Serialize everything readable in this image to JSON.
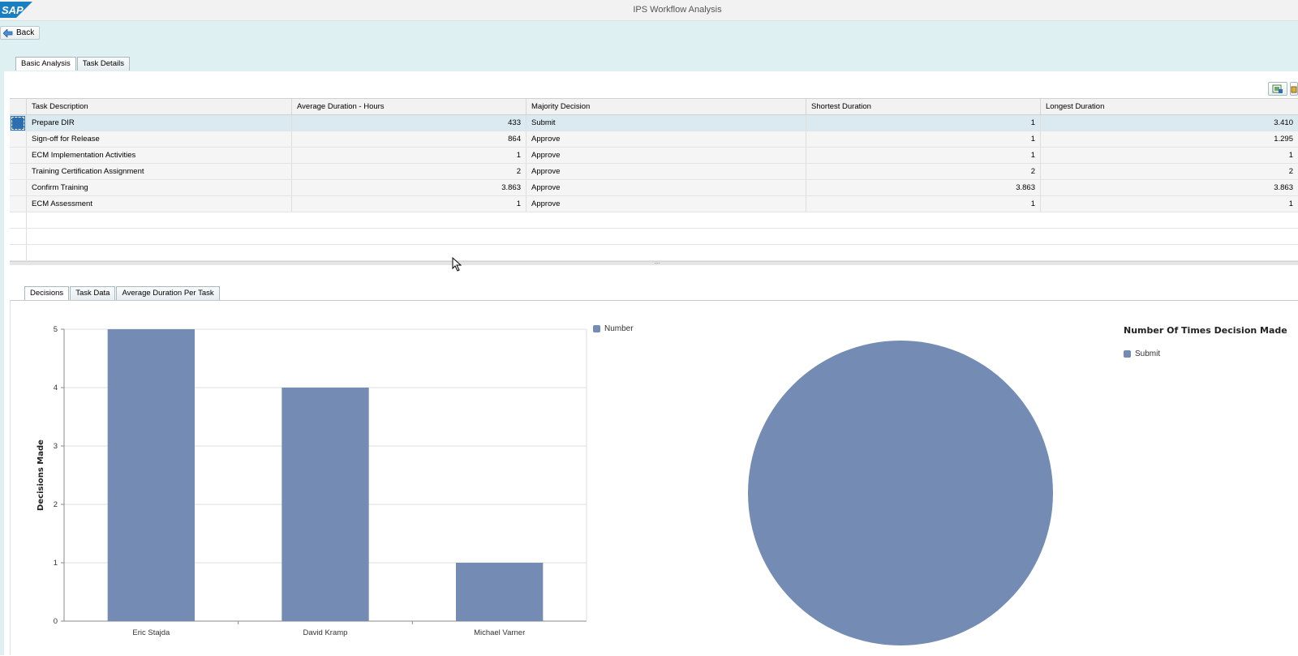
{
  "app": {
    "logo_text": "SAP",
    "title": "IPS Workflow Analysis"
  },
  "toolbar": {
    "back_label": "Back"
  },
  "top_tabs": [
    {
      "label": "Basic Analysis",
      "active": true
    },
    {
      "label": "Task Details",
      "active": false
    }
  ],
  "grid": {
    "columns": [
      "Task Description",
      "Average Duration - Hours",
      "Majority Decision",
      "Shortest Duration",
      "Longest Duration"
    ],
    "rows": [
      [
        "Prepare DIR",
        "433",
        "Submit",
        "1",
        "3.410"
      ],
      [
        "Sign-off for Release",
        "864",
        "Approve",
        "1",
        "1.295"
      ],
      [
        "ECM Implementation Activities",
        "1",
        "Approve",
        "1",
        "1"
      ],
      [
        "Training Certification Assignment",
        "2",
        "Approve",
        "2",
        "2"
      ],
      [
        "Confirm Training",
        "3.863",
        "Approve",
        "3.863",
        "3.863"
      ],
      [
        "ECM Assessment",
        "1",
        "Approve",
        "1",
        "1"
      ]
    ],
    "selected_row": 0
  },
  "bottom_tabs": [
    {
      "label": "Decisions",
      "active": true
    },
    {
      "label": "Task Data",
      "active": false
    },
    {
      "label": "Average Duration Per Task",
      "active": false
    }
  ],
  "colors": {
    "series": "#748cb3",
    "accent": "#2b6fb2"
  },
  "chart_data": [
    {
      "type": "bar",
      "categories": [
        "Eric Stajda",
        "David Kramp",
        "Michael Varner"
      ],
      "series": [
        {
          "name": "Number",
          "values": [
            5,
            4,
            1
          ]
        }
      ],
      "ylabel": "Decisions Made",
      "xlabel": "",
      "ylim": [
        0,
        5
      ],
      "yticks": [
        "0",
        "1",
        "2",
        "3",
        "4",
        "5"
      ],
      "legend": "top-right",
      "grid": true
    },
    {
      "type": "pie",
      "title": "Number Of Times Decision Made",
      "slices": [
        {
          "label": "Submit",
          "value": 1
        }
      ],
      "legend": "top-right"
    }
  ]
}
